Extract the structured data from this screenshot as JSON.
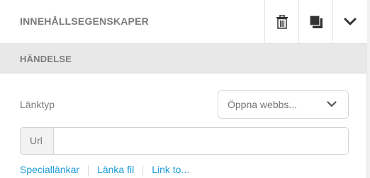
{
  "header": {
    "title": "INNEHÅLLSEGENSKAPER",
    "buttons": [
      {
        "icon": "trash-icon"
      },
      {
        "icon": "copy-icon"
      },
      {
        "icon": "chevron-down-icon"
      }
    ]
  },
  "section": {
    "title": "HÄNDELSE"
  },
  "link_type": {
    "label": "Länktyp",
    "selected": "Öppna webbs..."
  },
  "url": {
    "addon_label": "Url",
    "value": "",
    "placeholder": ""
  },
  "links": [
    {
      "label": "Speciallänkar"
    },
    {
      "label": "Länka fil"
    },
    {
      "label": "Link to..."
    }
  ],
  "colors": {
    "link": "#1e9bd7",
    "section_bg": "#e8e8e8",
    "text_muted": "#7a7a7a"
  }
}
